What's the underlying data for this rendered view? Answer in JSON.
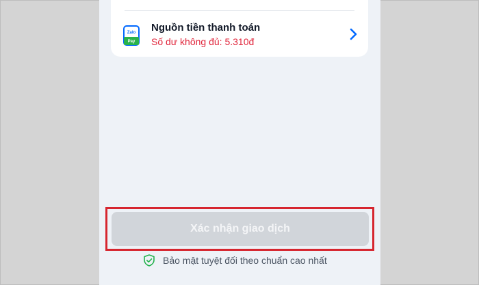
{
  "payment_source": {
    "icon_label_top": "Zalo",
    "icon_label_bottom": "Pay",
    "title": "Nguồn tiền thanh toán",
    "balance_text": "Số dư không đủ: 5.310đ",
    "icon": "zalopay-icon",
    "action_icon": "chevron-right-icon"
  },
  "confirm_button": {
    "label": "Xác nhận giao dịch",
    "state": "disabled"
  },
  "security_note": {
    "icon": "shield-check-icon",
    "text": "Bảo mật tuyệt đối theo chuẩn cao nhất"
  },
  "colors": {
    "warning_red": "#e0243a",
    "highlight_red": "#d6262f",
    "accent_blue": "#0068ff",
    "shield_green": "#22b24c",
    "disabled_button": "#d1d5da"
  }
}
